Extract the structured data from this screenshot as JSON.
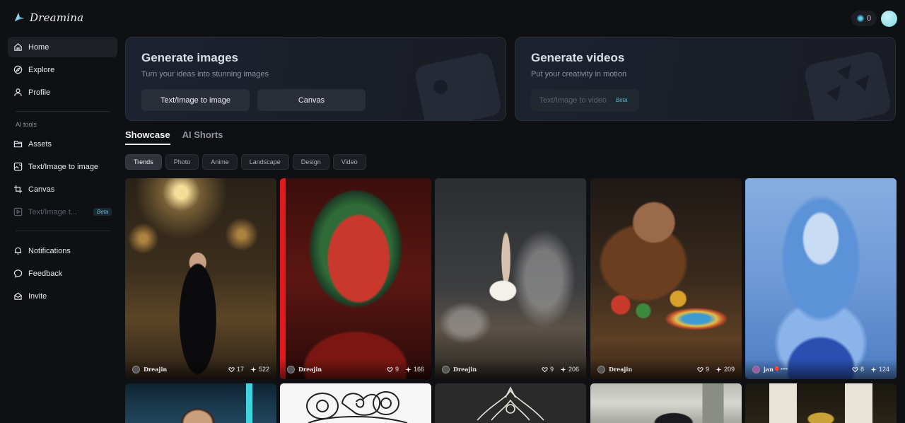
{
  "app": {
    "name": "Dreamina"
  },
  "header": {
    "credits": "0"
  },
  "sidebar": {
    "items": [
      {
        "label": "Home",
        "icon": "home-icon"
      },
      {
        "label": "Explore",
        "icon": "compass-icon"
      },
      {
        "label": "Profile",
        "icon": "user-icon"
      }
    ],
    "group_label": "AI tools",
    "tools": [
      {
        "label": "Assets",
        "icon": "folder-icon"
      },
      {
        "label": "Text/Image to image",
        "icon": "image-edit-icon"
      },
      {
        "label": "Canvas",
        "icon": "crop-icon"
      },
      {
        "label": "Text/Image t...",
        "icon": "video-icon",
        "badge": "Beta"
      }
    ],
    "bottom": [
      {
        "label": "Notifications",
        "icon": "bell-icon"
      },
      {
        "label": "Feedback",
        "icon": "chat-icon"
      },
      {
        "label": "Invite",
        "icon": "gift-icon"
      }
    ]
  },
  "hero": {
    "images": {
      "title": "Generate images",
      "subtitle": "Turn your ideas into stunning images",
      "button_1": "Text/Image to image",
      "button_2": "Canvas"
    },
    "videos": {
      "title": "Generate videos",
      "subtitle": "Put your creativity in motion",
      "button_1": "Text/Image to video",
      "badge": "Beta"
    }
  },
  "tabs": [
    "Showcase",
    "AI Shorts"
  ],
  "filters": [
    "Trends",
    "Photo",
    "Anime",
    "Landscape",
    "Design",
    "Video"
  ],
  "cards": [
    {
      "author": "Dreajin",
      "likes": "17",
      "uses": "522"
    },
    {
      "author": "Dreajin",
      "likes": "9",
      "uses": "166"
    },
    {
      "author": "Dreajin",
      "likes": "9",
      "uses": "206"
    },
    {
      "author": "Dreajin",
      "likes": "9",
      "uses": "209"
    },
    {
      "author": "jan🎈ᶻᵒᵉ",
      "likes": "8",
      "uses": "124"
    }
  ]
}
